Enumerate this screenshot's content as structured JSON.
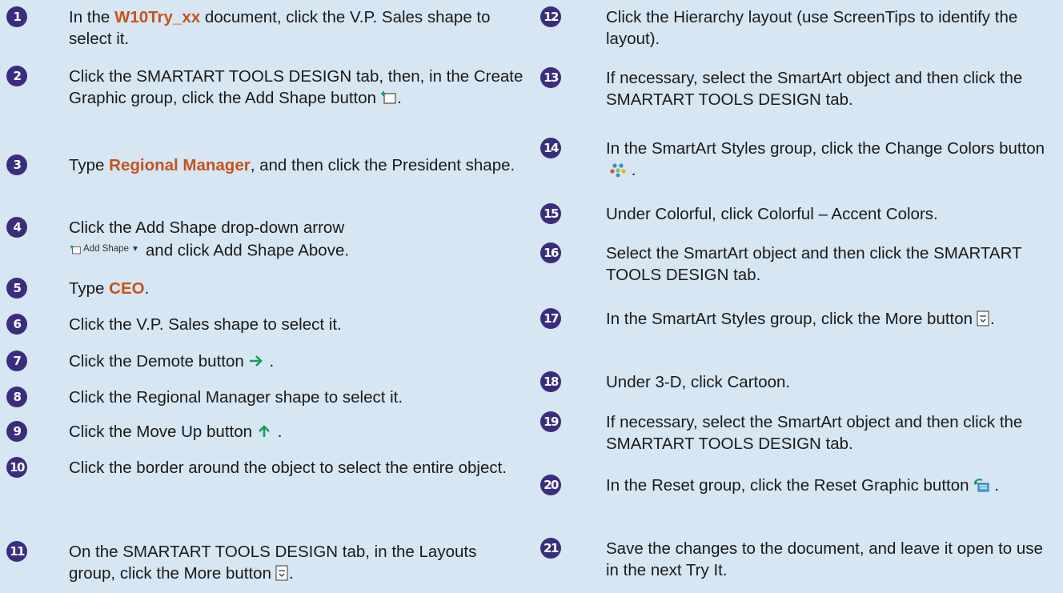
{
  "left_steps": [
    {
      "num": "1",
      "pre": "In the ",
      "hl": "W10Try_xx",
      "post": " document, click the V.P. Sales shape to select it."
    },
    {
      "num": "2",
      "pre": "Click the SMARTART TOOLS DESIGN tab, then, in the Create Graphic group, click the Add Shape button",
      "post": "."
    },
    {
      "num": "3",
      "pre": "Type ",
      "hl": "Regional Manager",
      "post": ", and then click the President shape."
    },
    {
      "num": "4",
      "pre": "Click the Add Shape drop-down arrow",
      "icon_label": "Add Shape",
      "post": "and click Add Shape Above."
    },
    {
      "num": "5",
      "pre": "Type ",
      "hl": "CEO",
      "post": "."
    },
    {
      "num": "6",
      "pre": "Click the V.P. Sales shape to select it."
    },
    {
      "num": "7",
      "pre": "Click the Demote button",
      "post": " ."
    },
    {
      "num": "8",
      "pre": "Click the Regional Manager shape to select it."
    },
    {
      "num": "9",
      "pre": "Click the Move Up button",
      "post": " ."
    },
    {
      "num": "10",
      "pre": "Click the border around the object to select the entire object."
    },
    {
      "num": "11",
      "pre": "On the SMARTART TOOLS DESIGN tab, in the Layouts group, click the More button",
      "post": "."
    }
  ],
  "right_steps": [
    {
      "num": "12",
      "pre": "Click the Hierarchy layout (use ScreenTips to identify the layout)."
    },
    {
      "num": "13",
      "pre": "If necessary, select the SmartArt object and then click the SMARTART TOOLS DESIGN tab."
    },
    {
      "num": "14",
      "pre": "In the SmartArt Styles group, click the Change Colors button",
      "post": " ."
    },
    {
      "num": "15",
      "pre": "Under Colorful, click Colorful – Accent Colors."
    },
    {
      "num": "16",
      "pre": "Select the SmartArt object and then click the SMARTART TOOLS DESIGN tab."
    },
    {
      "num": "17",
      "pre": "In the SmartArt Styles group, click the More button",
      "post": "."
    },
    {
      "num": "18",
      "pre": "Under 3-D, click Cartoon."
    },
    {
      "num": "19",
      "pre": "If necessary, select the SmartArt object and then click the SMARTART TOOLS DESIGN tab."
    },
    {
      "num": "20",
      "pre": "In the Reset group, click the Reset Graphic button",
      "post": " ."
    },
    {
      "num": "21",
      "pre": "Save the changes to the document, and leave it open to use in the next Try It."
    }
  ],
  "colors": {
    "background": "#d6e6f2",
    "number_badge": "#3b2d7d",
    "highlight_text": "#c8521b",
    "icon_green": "#1a9a5a"
  },
  "icons": {
    "add_shape": "add-shape-icon",
    "demote": "demote-arrow-icon",
    "move_up": "move-up-arrow-icon",
    "more": "more-dropdown-icon",
    "change_colors": "change-colors-icon",
    "reset_graphic": "reset-graphic-icon"
  }
}
